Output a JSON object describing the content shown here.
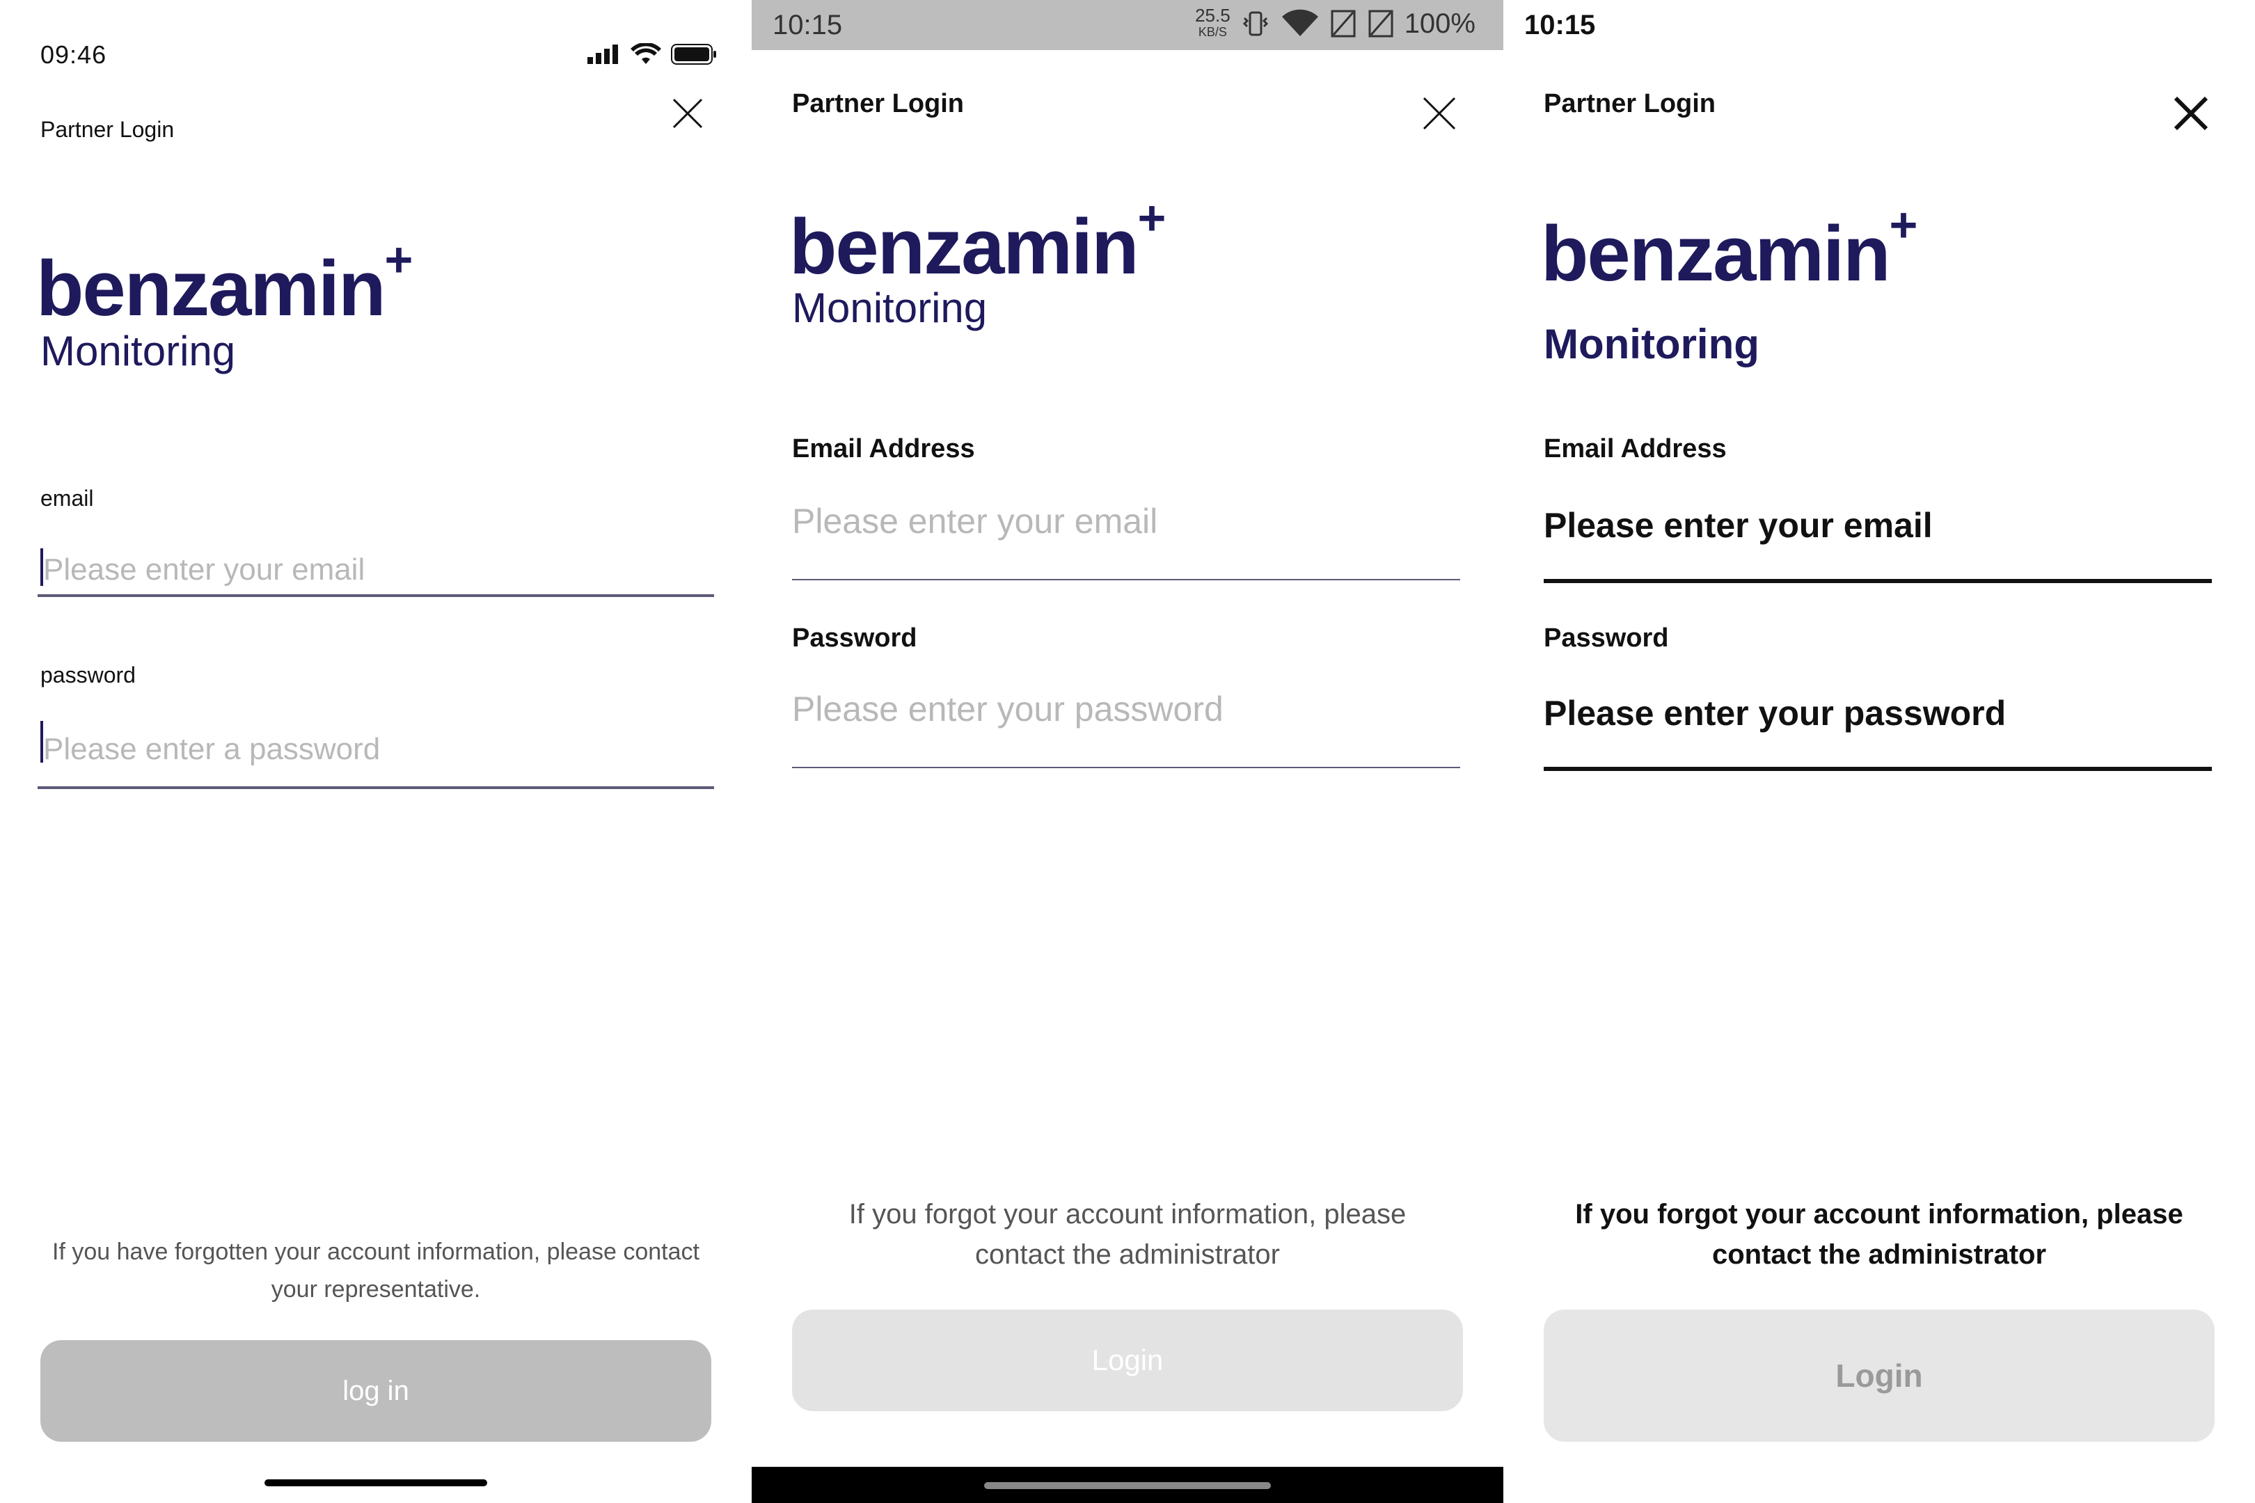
{
  "screen1": {
    "status": {
      "time": "09:46"
    },
    "header": {
      "title": "Partner Login"
    },
    "logo": {
      "word": "benzamin",
      "plus": "+",
      "sub": "Monitoring"
    },
    "email": {
      "label": "email",
      "placeholder": "Please enter your email"
    },
    "password": {
      "label": "password",
      "placeholder": "Please enter a password"
    },
    "footer": {
      "line1": "If you have forgotten your account information, please contact",
      "line2": "your representative."
    },
    "button": {
      "label": "log in"
    }
  },
  "screen2": {
    "status": {
      "time": "10:15",
      "speed": "25.5",
      "speed_unit": "KB/S",
      "battery": "100%"
    },
    "header": {
      "title": "Partner Login"
    },
    "logo": {
      "word": "benzamin",
      "plus": "+",
      "sub": "Monitoring"
    },
    "email": {
      "label": "Email Address",
      "placeholder": "Please enter your email"
    },
    "password": {
      "label": "Password",
      "placeholder": "Please enter your password"
    },
    "footer": {
      "line1": "If you forgot your account information, please",
      "line2": "contact the administrator"
    },
    "button": {
      "label": "Login"
    }
  },
  "screen3": {
    "status": {
      "time": "10:15"
    },
    "header": {
      "title": "Partner Login"
    },
    "logo": {
      "word": "benzamin",
      "plus": "+",
      "sub": "Monitoring"
    },
    "email": {
      "label": "Email Address",
      "placeholder": "Please enter your email"
    },
    "password": {
      "label": "Password",
      "placeholder": "Please enter your password"
    },
    "footer": {
      "line1": "If you forgot your account information, please",
      "line2": "contact the administrator"
    },
    "button": {
      "label": "Login"
    }
  },
  "colors": {
    "brand_navy": "#1e1a5c",
    "button_gray": "#bdbdbd",
    "button_light": "#e3e3e3"
  }
}
